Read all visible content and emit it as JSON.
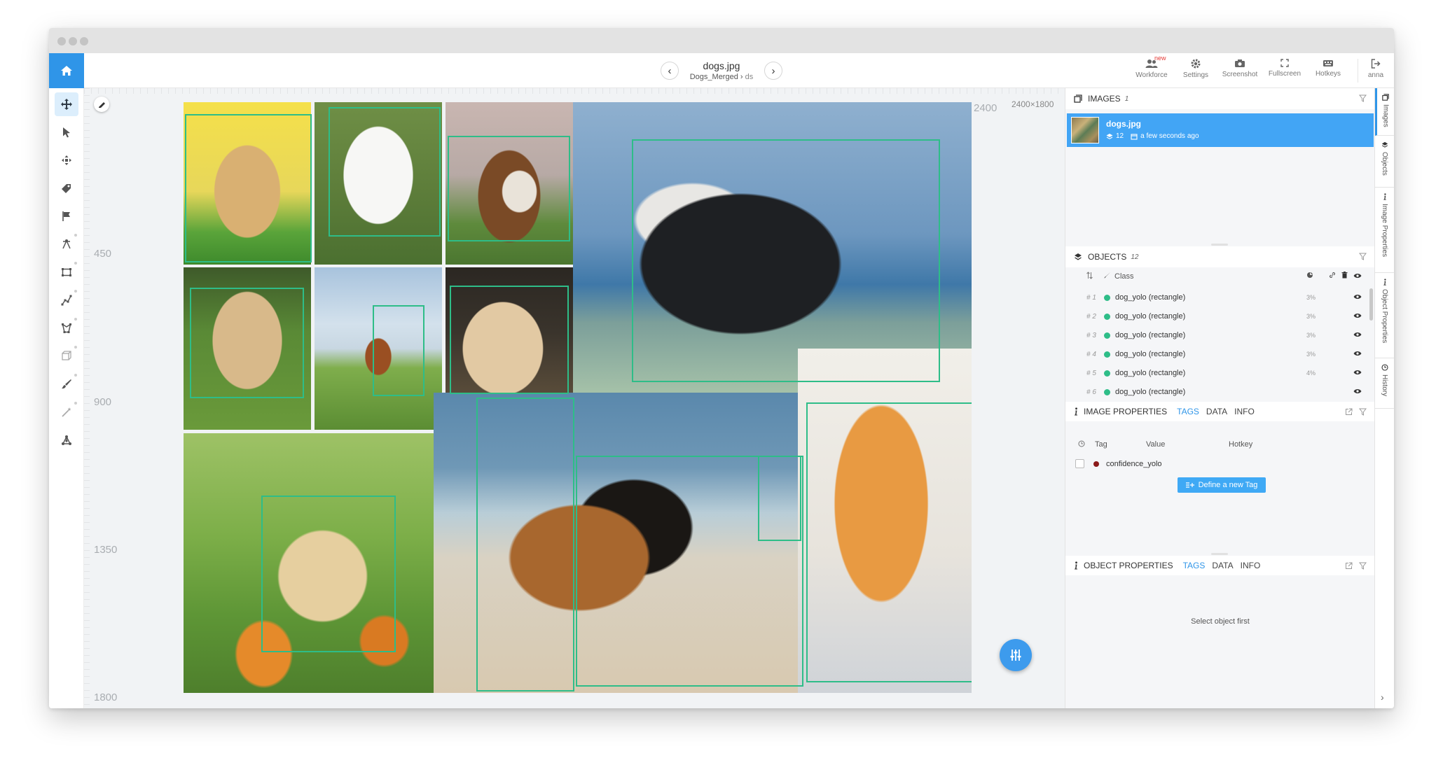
{
  "header": {
    "file_name": "dogs.jpg",
    "project": "Dogs_Merged",
    "path_sep": "›",
    "dataset": "ds",
    "prev_arrow": "‹",
    "next_arrow": "›",
    "tools": [
      {
        "label": "Workforce",
        "badge": "new"
      },
      {
        "label": "Settings"
      },
      {
        "label": "Screenshot"
      },
      {
        "label": "Fullscreen"
      },
      {
        "label": "Hotkeys"
      },
      {
        "label": "anna"
      }
    ]
  },
  "canvas": {
    "image_size": "2400×1800",
    "x_marker": "2400",
    "y_labels": [
      "450",
      "900",
      "1350",
      "1800"
    ]
  },
  "images_panel": {
    "title": "IMAGES",
    "count": "1",
    "item": {
      "name": "dogs.jpg",
      "objects": "12",
      "time": "a few seconds ago"
    }
  },
  "objects_panel": {
    "title": "OBJECTS",
    "count": "12",
    "column_class": "Class",
    "rows": [
      {
        "index": "# 1",
        "name": "dog_yolo (rectangle)",
        "pct": "3%"
      },
      {
        "index": "# 2",
        "name": "dog_yolo (rectangle)",
        "pct": "3%"
      },
      {
        "index": "# 3",
        "name": "dog_yolo (rectangle)",
        "pct": "3%"
      },
      {
        "index": "# 4",
        "name": "dog_yolo (rectangle)",
        "pct": "3%"
      },
      {
        "index": "# 5",
        "name": "dog_yolo (rectangle)",
        "pct": "4%"
      },
      {
        "index": "# 6",
        "name": "dog_yolo (rectangle)",
        "pct": ""
      }
    ]
  },
  "image_properties": {
    "title": "IMAGE PROPERTIES",
    "tabs": [
      "TAGS",
      "DATA",
      "INFO"
    ],
    "columns": [
      "Tag",
      "Value",
      "Hotkey"
    ],
    "tag": "confidence_yolo",
    "define_button": "Define a new Tag"
  },
  "object_properties": {
    "title": "OBJECT PROPERTIES",
    "tabs": [
      "TAGS",
      "DATA",
      "INFO"
    ],
    "empty_text": "Select object first"
  },
  "side_tabs": [
    "Images",
    "Objects",
    "Image Properties",
    "Object Properties",
    "History"
  ],
  "colors": {
    "accent": "#2f95e8",
    "bbox": "#2ebd88",
    "selected_row": "#42a5f5",
    "tag_dot": "#8b1a1a"
  }
}
